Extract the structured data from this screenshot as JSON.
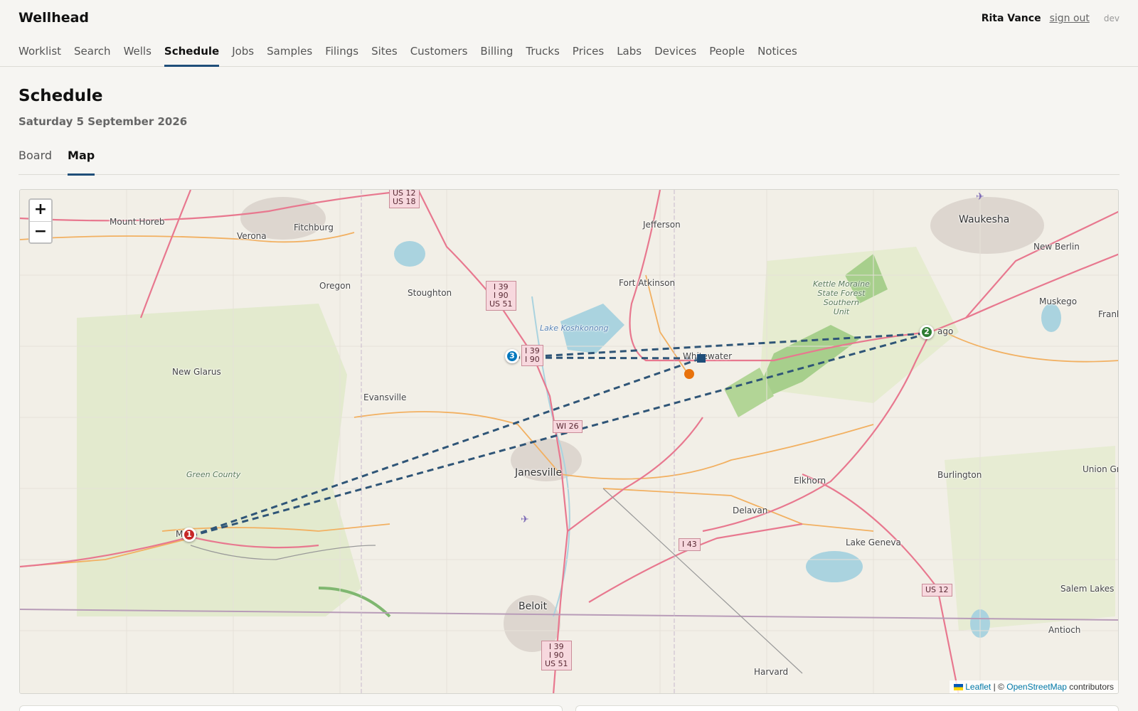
{
  "app": {
    "brand": "Wellhead"
  },
  "user": {
    "name": "Rita Vance",
    "sign_out": "sign out",
    "env": "dev"
  },
  "nav": {
    "items": [
      "Worklist",
      "Search",
      "Wells",
      "Schedule",
      "Jobs",
      "Samples",
      "Filings",
      "Sites",
      "Customers",
      "Billing",
      "Trucks",
      "Prices",
      "Labs",
      "Devices",
      "People",
      "Notices"
    ],
    "active": "Schedule"
  },
  "page": {
    "title": "Schedule",
    "date": "Saturday 5 September 2026"
  },
  "tabs": {
    "board": "Board",
    "map": "Map",
    "active": "Map"
  },
  "map": {
    "zoom_in": "+",
    "zoom_out": "−",
    "places": {
      "mount_horeb": "Mount Horeb",
      "verona": "Verona",
      "fitchburg": "Fitchburg",
      "oregon": "Oregon",
      "stoughton": "Stoughton",
      "jefferson": "Jefferson",
      "fort_atkinson": "Fort Atkinson",
      "waukesha": "Waukesha",
      "new_berlin": "New Berlin",
      "muskego": "Muskego",
      "frank": "Frank",
      "new_glarus": "New Glarus",
      "evansville": "Evansville",
      "whitewater": "Whitewater",
      "mukwonago": "ago",
      "janesville": "Janesville",
      "elkhorn": "Elkhorn",
      "delavan": "Delavan",
      "burlington": "Burlington",
      "union_grove": "Union Gr",
      "lake_geneva": "Lake Geneva",
      "salem_lakes": "Salem Lakes",
      "antioch": "Antioch",
      "beloit": "Beloit",
      "harvard": "Harvard",
      "monroe": "M   e",
      "green_county": "Green County",
      "lake_koshkonong": "Lake Koshkonong",
      "kettle_moraine": "Kettle Moraine\nState Forest\nSouthern\nUnit"
    },
    "shields": {
      "us12_us18": "US 12\nUS 18",
      "i39_i90_us51_n": "I 39\nI 90\nUS 51",
      "i39_i90": "I 39\nI 90",
      "wi26": "WI 26",
      "i43": "I 43",
      "us12": "US 12",
      "i39_i90_us51_s": "I 39\nI 90\nUS 51"
    },
    "stops": [
      {
        "label": "1",
        "color": "#c62828"
      },
      {
        "label": "2",
        "color": "#2e7d32"
      },
      {
        "label": "3",
        "color": "#0277bd"
      }
    ],
    "route_color": "#2f5577",
    "attribution": {
      "leaflet": "Leaflet",
      "separator": "| ©",
      "osm": "OpenStreetMap",
      "suffix": "contributors"
    }
  }
}
